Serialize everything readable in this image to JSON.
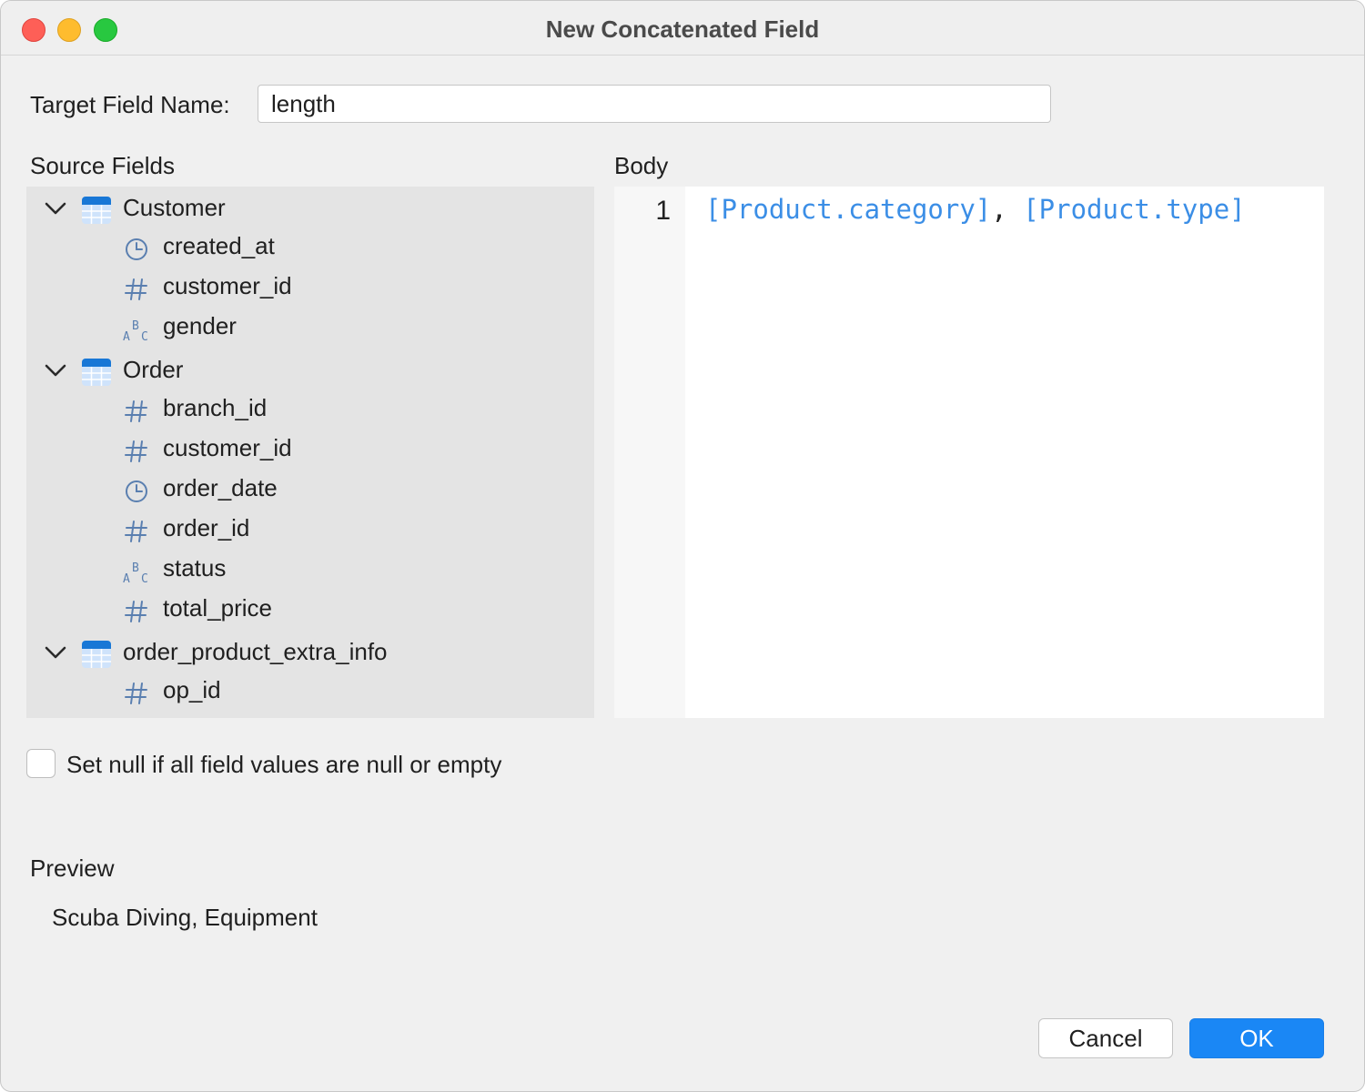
{
  "window": {
    "title": "New Concatenated Field"
  },
  "target": {
    "label": "Target Field Name:",
    "value": "length"
  },
  "source": {
    "label": "Source Fields",
    "groups": [
      {
        "name": "Customer",
        "fields": [
          {
            "name": "created_at",
            "type": "datetime"
          },
          {
            "name": "customer_id",
            "type": "number"
          },
          {
            "name": "gender",
            "type": "text"
          }
        ]
      },
      {
        "name": "Order",
        "fields": [
          {
            "name": "branch_id",
            "type": "number"
          },
          {
            "name": "customer_id",
            "type": "number"
          },
          {
            "name": "order_date",
            "type": "datetime"
          },
          {
            "name": "order_id",
            "type": "number"
          },
          {
            "name": "status",
            "type": "text"
          },
          {
            "name": "total_price",
            "type": "number"
          }
        ]
      },
      {
        "name": "order_product_extra_info",
        "fields": [
          {
            "name": "op_id",
            "type": "number"
          }
        ]
      }
    ]
  },
  "body": {
    "label": "Body",
    "line_number": "1",
    "tokens": [
      "[Product.category]",
      ", ",
      "[Product.type]"
    ]
  },
  "options": {
    "null_label": "Set null if all field values are null or empty",
    "null_checked": false
  },
  "preview": {
    "label": "Preview",
    "value": "Scuba Diving, Equipment"
  },
  "buttons": {
    "cancel": "Cancel",
    "ok": "OK"
  },
  "colors": {
    "accent": "#1a87f5",
    "reference": "#3b8ee6",
    "icon": "#5a7fb0"
  }
}
